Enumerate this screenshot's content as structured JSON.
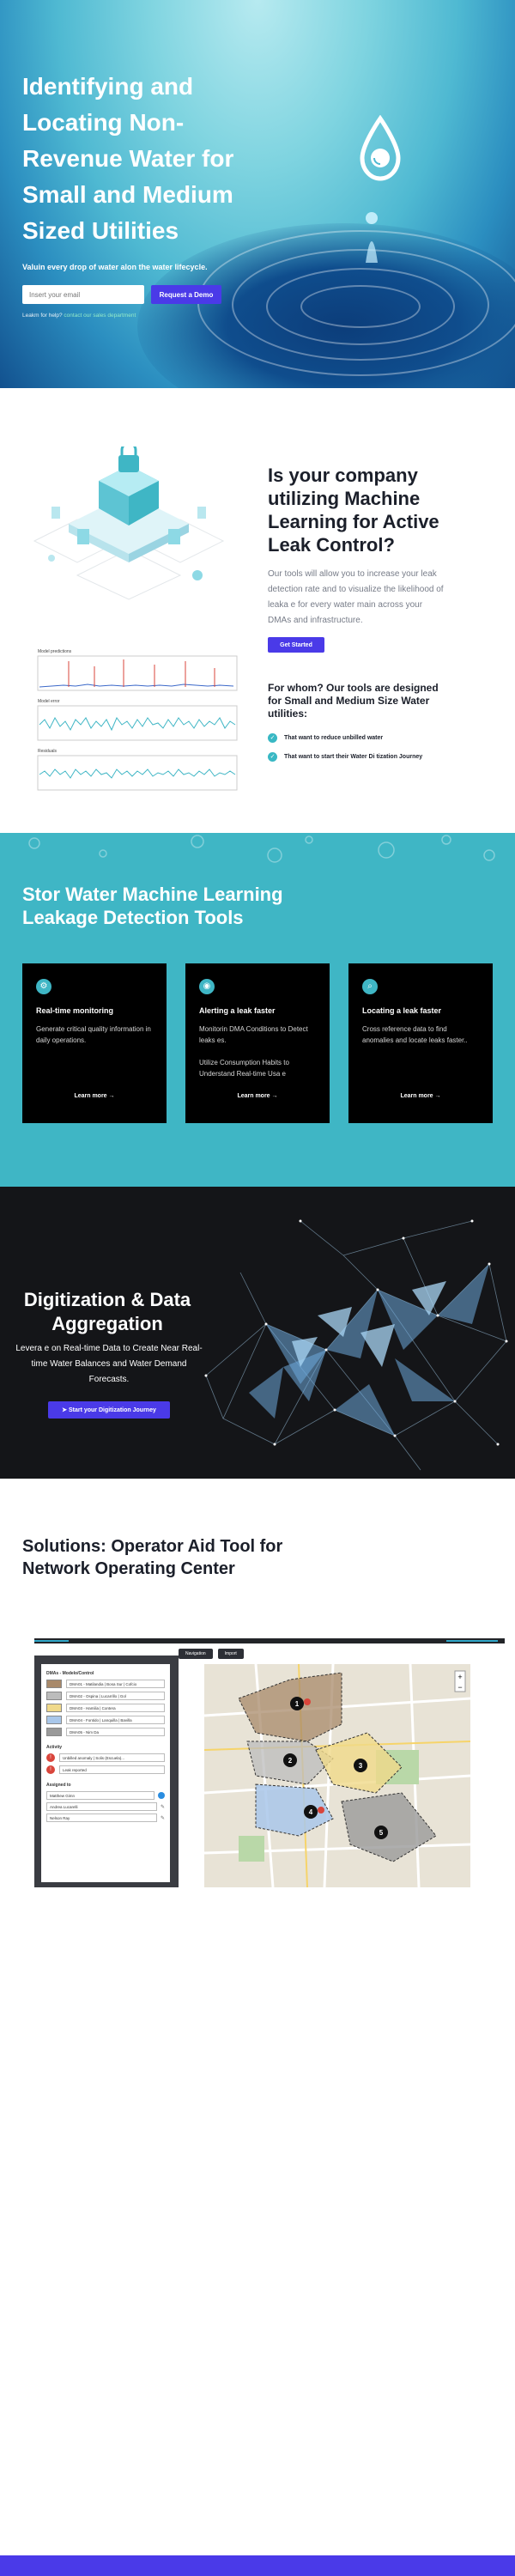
{
  "hero": {
    "title": "Identifying and Locating Non-Revenue Water for Small and Medium Sized Utilities",
    "subtitle": "Valuin   every drop of water alon   the water lifecycle.",
    "email_placeholder": "Insert your email",
    "cta_label": "Request a Demo",
    "note_prefix": "Leakm   for help? ",
    "note_link": "contact our sales department"
  },
  "machine_learning": {
    "title": "Is your company utilizing Machine Learning for Active Leak Control?",
    "text": "Our tools will allow you to increase your leak detection rate and to visualize the likelihood of leaka   e for every water main across your DMAs and infrastructure.",
    "cta_label": "Get Started",
    "for_whom_title": "For whom? Our tools are designed for Small and Medium Size Water utilities:",
    "checklist": [
      "That want to reduce unbilled water",
      "That want to start their Water Di   tization Journey"
    ],
    "chart_labels": [
      "Model predictions",
      "Model error",
      "Residuals"
    ]
  },
  "tools": {
    "title": "Stor Water Machine Learning Leakage Detection Tools",
    "cards": [
      {
        "icon": "gear-icon",
        "title": "Real-time monitoring",
        "text": "Generate critical quality information in daily operations.",
        "link": "Learn more"
      },
      {
        "icon": "signal-icon",
        "title": "Alerting a leak faster",
        "text": "Monitorin   DMA Conditions to Detect leaks   es.\n\nUtilize Consumption Habits to Understand Real-time Usa   e",
        "link": "Learn more"
      },
      {
        "icon": "search-icon",
        "title": "Locating a leak faster",
        "text": "Cross reference data to find anomalies and locate leaks faster..",
        "link": "Learn more"
      }
    ]
  },
  "digitization": {
    "title": "Digitization & Data Aggregation",
    "text": "Levera   e on Real-time Data to Create Near Real-time Water Balances and Water Demand Forecasts.",
    "cta_label": "Start your Digitization Journey"
  },
  "solutions": {
    "title": "Solutions: Operator Aid Tool for Network Operating Center",
    "toolbar": [
      "Navigation",
      "Import"
    ],
    "panel_heading": "DMAs - Modelo/Control",
    "dmas": [
      {
        "label": "DMA01 - Matilandia | Bosa Sur | Cofcio",
        "color": "#a8896a"
      },
      {
        "label": "DMA02 - Ospina | Lucarrillo | Gol",
        "color": "#bcbcbc"
      },
      {
        "label": "DMA03 - Hamilia | Contera",
        "color": "#f0d98a"
      },
      {
        "label": "DMA04 - Fontido | Lanquilla | Bavilla",
        "color": "#a9c7ea"
      },
      {
        "label": "DMA05 - Nim Da",
        "color": "#9a9a9a"
      }
    ],
    "activity_heading": "Activity",
    "activities": [
      "Unbilled anomaly | Solis (Escuela)...",
      "Leak reported"
    ],
    "assigned_heading": "Assigned to",
    "assignees": [
      "Matthew Gimn",
      "Andrea Lucarelli",
      "Nelson Ray"
    ],
    "map_markers": [
      "1",
      "2",
      "3",
      "4",
      "5"
    ]
  },
  "colors": {
    "accent": "#4a3ae8",
    "teal": "#3fb6c5",
    "dark": "#141518"
  }
}
